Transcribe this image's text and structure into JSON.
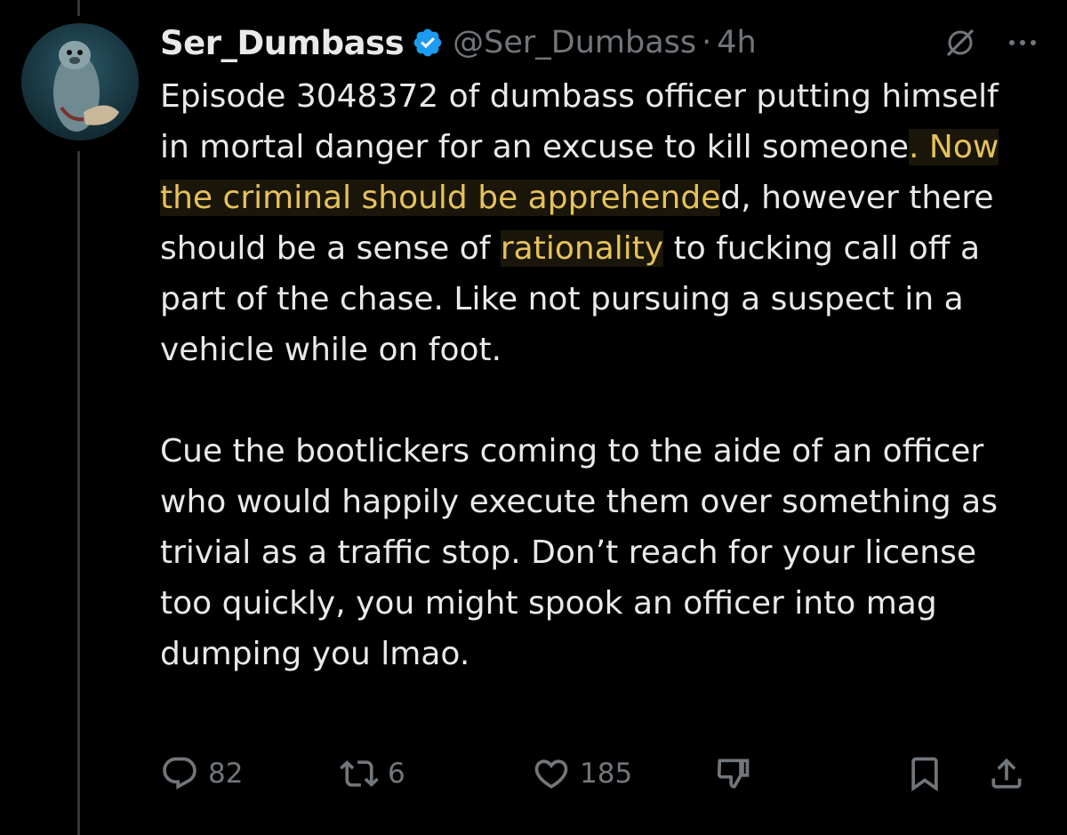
{
  "tweet": {
    "display_name": "Ser_Dumbass",
    "handle": "@Ser_Dumbass",
    "separator": "·",
    "time": "4h",
    "paragraph1": {
      "part1": "Episode 3048372 of dumbass officer putting himself in mortal danger for an excuse to kill someone",
      "highlight1": ". Now the criminal should be apprehende",
      "part2": "d, however there should be a sense of ",
      "highlight2": "rationality",
      "part3": " to fucking call off a part of the chase. Like not pursuing a suspect in a vehicle while on foot."
    },
    "paragraph2": "Cue the bootlickers coming to the aide of an officer who would happily execute them over something as trivial as a traffic stop. Don’t reach for your license too quickly, you might spook an officer into mag dumping you lmao."
  },
  "actions": {
    "replies": "82",
    "reposts": "6",
    "likes": "185"
  },
  "colors": {
    "background": "#000000",
    "text": "#e7e9ea",
    "muted": "#71767b",
    "verified": "#1d9bf0",
    "highlight": "#e6c25a"
  },
  "icons": [
    "verified-badge-icon",
    "grok-icon",
    "more-icon",
    "reply-icon",
    "repost-icon",
    "like-icon",
    "dislike-icon",
    "bookmark-icon",
    "share-icon"
  ]
}
